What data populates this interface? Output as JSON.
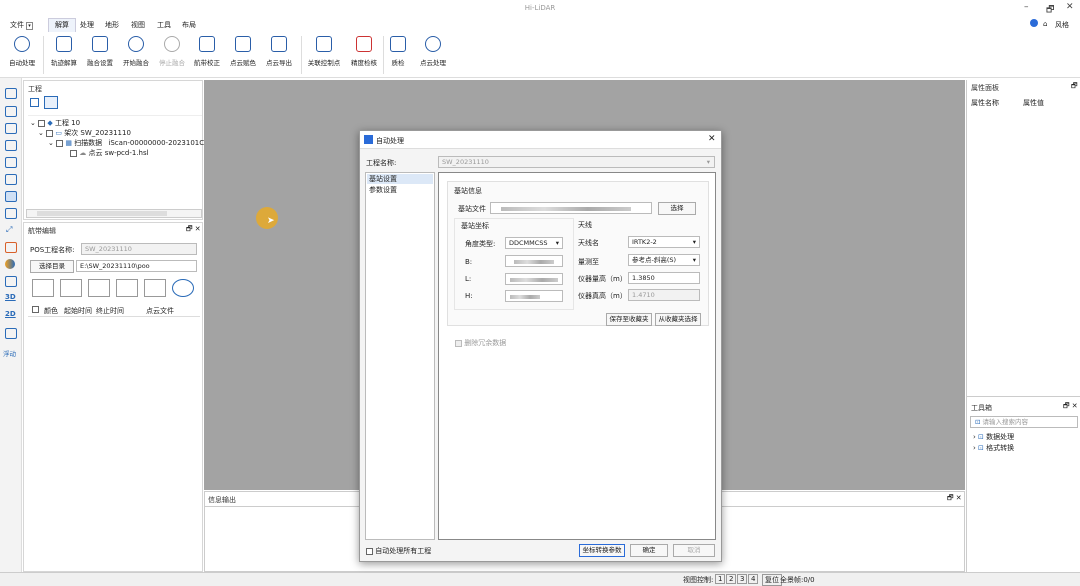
{
  "window": {
    "title": "Hi-LiDAR",
    "controls": [
      "–",
      "🗗",
      "✕"
    ]
  },
  "menubar": {
    "file": "文件",
    "items": [
      "解算",
      "处理",
      "地形",
      "视图",
      "工具",
      "布局"
    ],
    "style_label": "风格"
  },
  "ribbon": {
    "buttons": [
      "自动处理",
      "轨迹解算",
      "融合设置",
      "开始融合",
      "停止融合",
      "航带校正",
      "点云赋色",
      "点云导出",
      "关联控制点",
      "精度检核",
      "质检",
      "点云处理"
    ]
  },
  "project_panel": {
    "title": "工程",
    "tree": {
      "project": "工程 10",
      "session": "架次 SW_20231110",
      "scan": "扫描数据",
      "scan_id": "iScan-00000000-2023101C",
      "pointcloud_label": "点云",
      "pointcloud_file": "sw-pcd-1.hsl"
    }
  },
  "strip_panel": {
    "title": "航带编辑",
    "pos_label": "POS工程名称:",
    "pos_value": "SW_20231110",
    "select_dir": "选择目录",
    "dir_value": "E:\\SW_20231110\\poo",
    "columns": [
      "颜色",
      "起始时间",
      "终止时间",
      "点云文件"
    ]
  },
  "leftbar": {
    "float_label": "浮动",
    "label_3d": "3D",
    "label_2d": "2D"
  },
  "properties_panel": {
    "title": "属性面板",
    "col_name": "属性名称",
    "col_value": "属性值"
  },
  "toolbox": {
    "title": "工具箱",
    "search_placeholder": "请输入搜索内容",
    "items": [
      "数据处理",
      "格式转换"
    ]
  },
  "info_panel": {
    "title": "信息输出"
  },
  "statusbar": {
    "view_control": "视图控制:",
    "pages": [
      "1",
      "2",
      "3",
      "4"
    ],
    "reset": "复位",
    "frames": "全景帧:0/0"
  },
  "dialog": {
    "title": "自动处理",
    "project_label": "工程名称:",
    "project_value": "SW_20231110",
    "nav": [
      "基站设置",
      "参数设置"
    ],
    "base_info": "基站信息",
    "base_file_label": "基站文件",
    "select_btn": "选择",
    "base_coord": "基站坐标",
    "angle_type_label": "角度类型:",
    "angle_type_value": "DDCMMCSS",
    "b_label": "B:",
    "l_label": "L:",
    "h_label": "H:",
    "antenna": "天线",
    "antenna_name_label": "天线名",
    "antenna_name_value": "IRTK2-2",
    "measure_to_label": "量测至",
    "measure_to_value": "参考点-斜高(S)",
    "instr_height_label": "仪器量高（m）",
    "instr_height_value": "1.3850",
    "true_height_label": "仪器真高（m）",
    "true_height_value": "1.4710",
    "save_fav": "保存至收藏夹",
    "from_fav": "从收藏夹选择",
    "remove_redundant": "删除冗余数据",
    "auto_all": "自动处理所有工程",
    "coord_params": "坐标转换参数",
    "ok": "确定",
    "cancel": "取消"
  }
}
